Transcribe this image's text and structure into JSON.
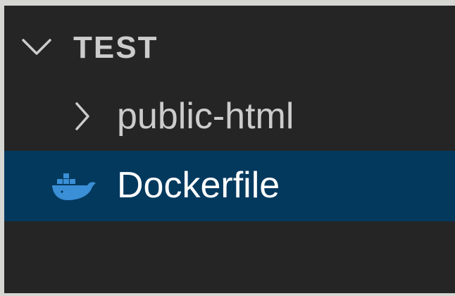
{
  "explorer": {
    "section_title": "TEST",
    "section_expanded": true,
    "items": [
      {
        "label": "public-html",
        "type": "folder",
        "expanded": false,
        "icon": "chevron-right-icon"
      },
      {
        "label": "Dockerfile",
        "type": "file",
        "selected": true,
        "icon": "docker-icon"
      }
    ]
  },
  "colors": {
    "background": "#252526",
    "selection": "#04395e",
    "text": "#cccccc",
    "selected_text": "#ffffff",
    "docker_blue": "#3a8fd6"
  }
}
